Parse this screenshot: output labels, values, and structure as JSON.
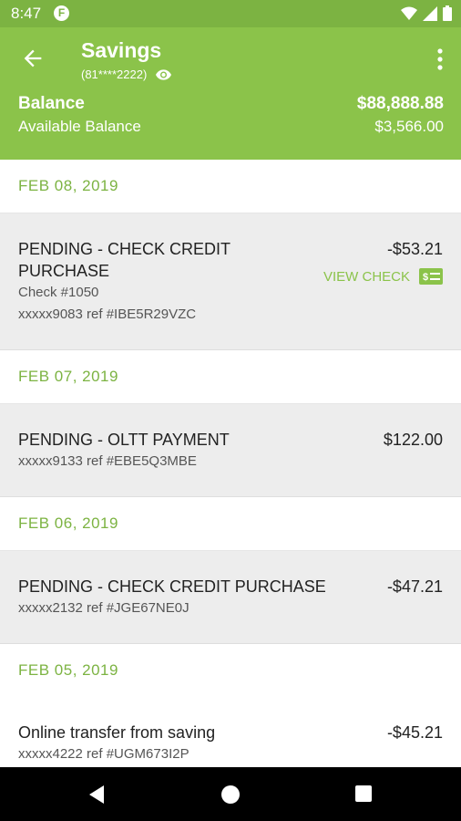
{
  "status_bar": {
    "time": "8:47",
    "app_icon": "F",
    "icons": [
      "wifi-icon",
      "signal-icon",
      "battery-icon"
    ]
  },
  "header": {
    "title": "Savings",
    "account_masked": "(81****2222)",
    "balance_label": "Balance",
    "balance_value": "$88,888.88",
    "available_label": "Available Balance",
    "available_value": "$3,566.00"
  },
  "colors": {
    "brand": "#8bc34a",
    "status_bar": "#7cb342",
    "row_gray": "#ededed"
  },
  "groups": [
    {
      "date": "FEB 08, 2019",
      "transactions": [
        {
          "description": "PENDING - CHECK CREDIT PURCHASE",
          "check_no": "Check #1050",
          "ref": "xxxxx9083 ref #IBE5R29VZC",
          "amount": "-$53.21",
          "action": "VIEW CHECK"
        }
      ]
    },
    {
      "date": "FEB 07, 2019",
      "transactions": [
        {
          "description": "PENDING - OLTT PAYMENT",
          "ref": "xxxxx9133 ref #EBE5Q3MBE",
          "amount": "$122.00"
        }
      ]
    },
    {
      "date": "FEB 06, 2019",
      "transactions": [
        {
          "description": "PENDING - CHECK CREDIT PURCHASE",
          "ref": "xxxxx2132 ref #JGE67NE0J",
          "amount": "-$47.21"
        }
      ]
    },
    {
      "date": "FEB 05, 2019",
      "transactions": [
        {
          "description": "Online transfer from saving",
          "ref": "xxxxx4222 ref #UGM673I2P",
          "amount": "-$45.21"
        }
      ]
    }
  ]
}
